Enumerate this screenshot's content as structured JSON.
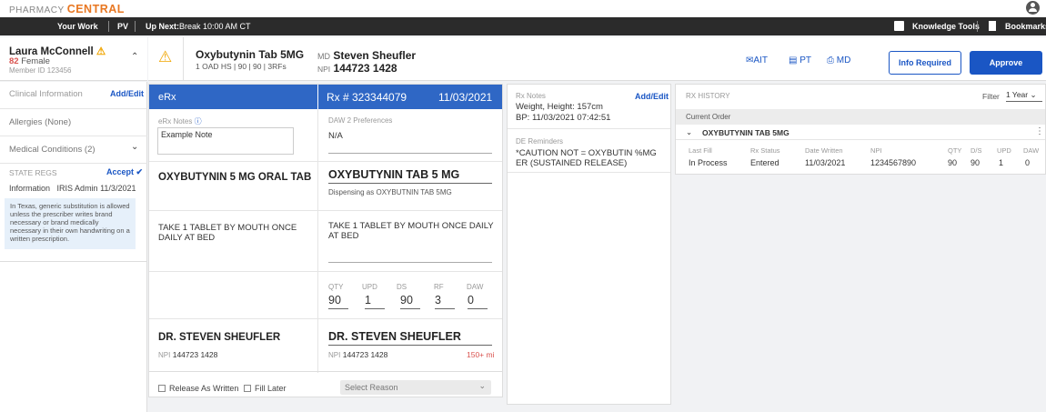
{
  "brand": {
    "prefix": "PHARMACY",
    "name": "CENTRAL"
  },
  "nav": {
    "your_work": "Your Work",
    "pv": "PV",
    "up_next": "Up Next:",
    "up_next_value": "Break 10:00 AM CT",
    "knowledge_tools": "Knowledge Tools",
    "bookmarks": "Bookmarks"
  },
  "patient": {
    "name": "Laura McConnell",
    "age": "82",
    "sex": "Female",
    "member_id": "Member ID 123456"
  },
  "left": {
    "clinical": "Clinical Information",
    "add_edit": "Add/Edit",
    "allergies": "Allergies (None)",
    "medical": "Medical Conditions (2)",
    "state_regs": "STATE REGS",
    "accept": "Accept",
    "info_label": "Information",
    "info_by": "IRIS Admin",
    "info_date": "11/3/2021",
    "note": "In Texas, generic substitution is allowed unless the prescriber writes brand necessary or brand medically necessary in their own handwriting on a written prescription."
  },
  "header": {
    "drug": "Oxybutynin Tab 5MG",
    "sig_short": "1 OAD HS | 90 | 90 | 3RFs",
    "md_label": "MD",
    "prescriber": "Steven Sheufler",
    "npi_label": "NPI",
    "npi": "144723 1428",
    "ait": "AIT",
    "pt": "PT",
    "md": "MD",
    "info_required": "Info Required",
    "approve": "Approve"
  },
  "erx": {
    "title": "eRx",
    "rx_number": "Rx # 323344079",
    "rx_date": "11/03/2021",
    "notes_label": "eRx Notes",
    "notes_value": "Example Note",
    "daw_label": "DAW 2 Preferences",
    "daw_value": "N/A",
    "drug_orig": "OXYBUTYNIN 5 MG ORAL TAB",
    "drug_new": "OXYBUTYNIN TAB 5 MG",
    "dispensing": "Dispensing as OXYBUTNIN TAB 5MG",
    "sig_orig": "TAKE 1 TABLET BY MOUTH ONCE DAILY AT BED",
    "sig_new": "TAKE 1 TABLET BY MOUTH ONCE DAILY AT BED",
    "qty_labels": [
      "QTY",
      "UPD",
      "DS",
      "RF",
      "DAW"
    ],
    "qty_values": [
      "90",
      "1",
      "90",
      "3",
      "0"
    ],
    "dr_orig": "DR. STEVEN SHEUFLER",
    "dr_new": "DR. STEVEN SHEUFLER",
    "npi_label": "NPI",
    "npi_orig": "144723 1428",
    "npi_new": "144723 1428",
    "distance": "150+ mi",
    "release": "Release As Written",
    "fill_later": "Fill Later",
    "select_reason": "Select Reason"
  },
  "notes": {
    "rx_notes": "Rx Notes",
    "add_edit": "Add/Edit",
    "line1": "Weight, Height: 157cm",
    "line2": "BP: 11/03/2021 07:42:51",
    "de_label": "DE Reminders",
    "de_text": "*CAUTION NOT = OXYBUTIN %MG ER (SUSTAINED RELEASE)"
  },
  "history": {
    "title": "RX HISTORY",
    "filter": "Filter",
    "filter_value": "1 Year",
    "current_order": "Current Order",
    "drug": "OXYBUTYNIN TAB 5MG",
    "headers": [
      "Last Fill",
      "Rx Status",
      "Date Written",
      "NPI",
      "QTY",
      "D/S",
      "UPD",
      "DAW"
    ],
    "values": [
      "In Process",
      "Entered",
      "11/03/2021",
      "1234567890",
      "90",
      "90",
      "1",
      "0"
    ]
  },
  "colors": {
    "accent": "#2f67c5",
    "brand": "#e87722",
    "warning": "#f0a500",
    "approve": "#1a56c4",
    "distance": "#d9534f"
  }
}
